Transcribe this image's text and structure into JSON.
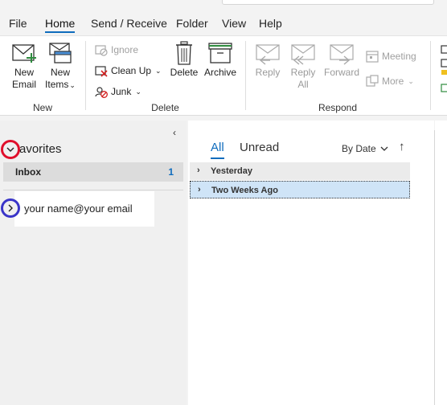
{
  "tabs": [
    {
      "label": "File"
    },
    {
      "label": "Home"
    },
    {
      "label": "Send / Receive"
    },
    {
      "label": "Folder"
    },
    {
      "label": "View"
    },
    {
      "label": "Help"
    }
  ],
  "ribbon": {
    "new_group": {
      "label": "New",
      "new_email": [
        "New",
        "Email"
      ],
      "new_items": [
        "New",
        "Items"
      ]
    },
    "delete_group": {
      "label": "Delete",
      "ignore": "Ignore",
      "clean_up": "Clean Up",
      "junk": "Junk",
      "delete": "Delete",
      "archive": "Archive"
    },
    "respond_group": {
      "label": "Respond",
      "reply": "Reply",
      "reply_all": [
        "Reply",
        "All"
      ],
      "forward": "Forward",
      "meeting": "Meeting",
      "more": "More"
    }
  },
  "folder_pane": {
    "favorites_label": "avorites",
    "inbox_label": "Inbox",
    "inbox_count": "1",
    "account_label": "your name@your email"
  },
  "message_list": {
    "filter_all": "All",
    "filter_unread": "Unread",
    "sort_label": "By Date",
    "groups": [
      {
        "label": "Yesterday"
      },
      {
        "label": "Two Weeks Ago"
      }
    ]
  },
  "colors": {
    "accent": "#0f6cbd",
    "annotation_red": "#e0102c",
    "annotation_blue": "#3a35c8",
    "selected_row": "#cfe4f7"
  }
}
